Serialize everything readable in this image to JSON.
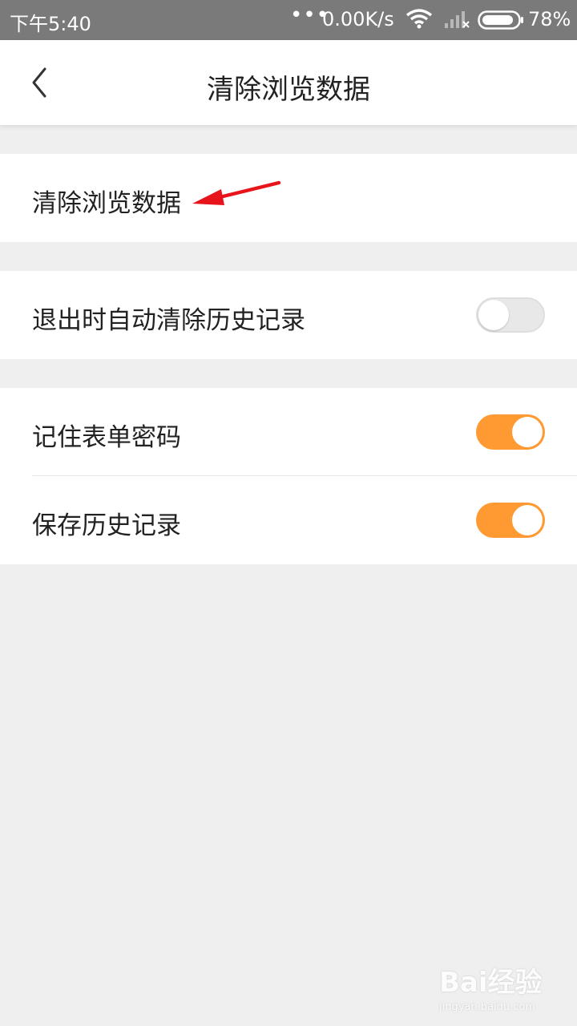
{
  "status_bar": {
    "time": "下午5:40",
    "dots": "•••",
    "network_speed": "0.00K/s",
    "battery_percent": "78%"
  },
  "header": {
    "title": "清除浏览数据",
    "back_icon": "chevron-left-icon"
  },
  "sections": {
    "clear": {
      "label": "清除浏览数据"
    },
    "auto_clear": {
      "label": "退出时自动清除历史记录",
      "enabled": false
    },
    "remember_password": {
      "label": "记住表单密码",
      "enabled": true
    },
    "save_history": {
      "label": "保存历史记录",
      "enabled": true
    }
  },
  "colors": {
    "accent": "#ff9932",
    "annotation_arrow": "#e8141b",
    "background": "#efefef"
  },
  "watermark": {
    "main": "Bai经验",
    "sub": "jingyan.baidu.com"
  }
}
